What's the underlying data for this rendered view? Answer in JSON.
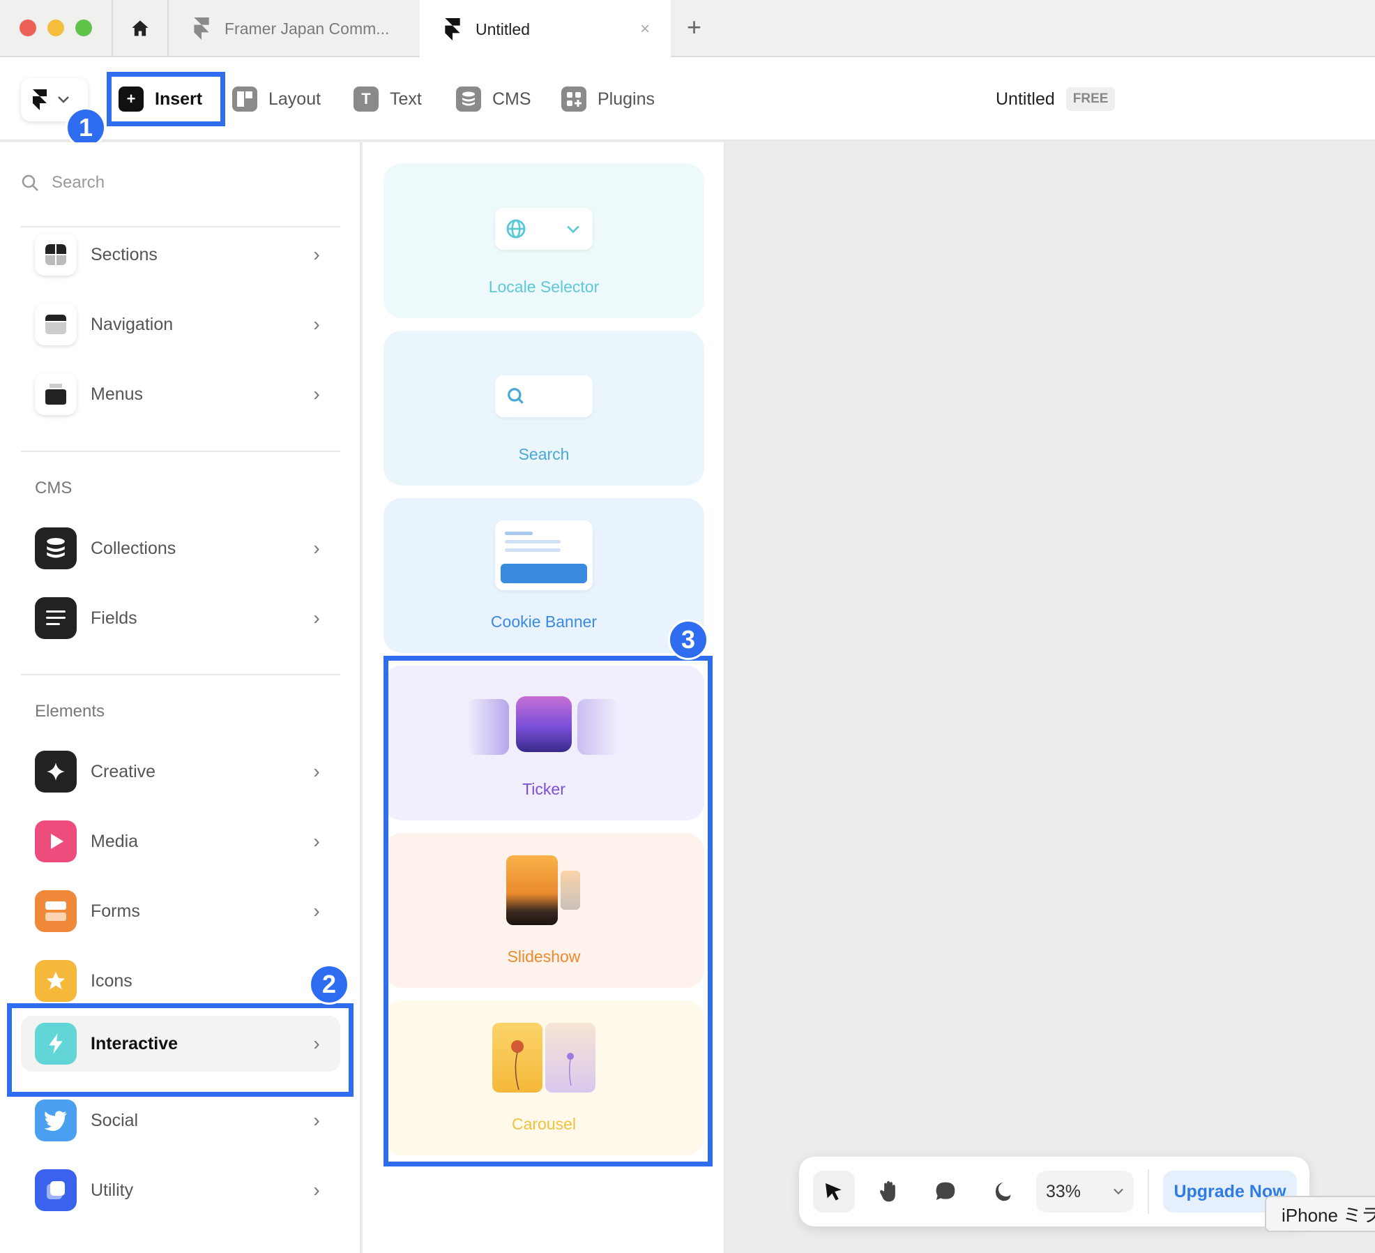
{
  "browser": {
    "tabs": [
      {
        "label": "Framer Japan Comm..."
      },
      {
        "label": "Untitled"
      }
    ],
    "new_tab": "+",
    "close": "×"
  },
  "toolbar": {
    "insert": "Insert",
    "layout": "Layout",
    "text": "Text",
    "cms": "CMS",
    "plugins": "Plugins",
    "project_title": "Untitled",
    "plan_badge": "FREE"
  },
  "annotations": [
    "1",
    "2",
    "3"
  ],
  "sidebar": {
    "search_placeholder": "Search",
    "sections": [
      {
        "label": "Sections",
        "icon": "sections-grid-icon"
      },
      {
        "label": "Navigation",
        "icon": "navigation-bar-icon"
      },
      {
        "label": "Menus",
        "icon": "menus-icon"
      }
    ],
    "cms_title": "CMS",
    "cms_items": [
      {
        "label": "Collections",
        "icon": "database-icon"
      },
      {
        "label": "Fields",
        "icon": "fields-lines-icon"
      }
    ],
    "elements_title": "Elements",
    "elements": [
      {
        "label": "Creative",
        "icon": "sparkle-icon",
        "color": "#222222"
      },
      {
        "label": "Media",
        "icon": "play-icon",
        "color": "#ec4d7c"
      },
      {
        "label": "Forms",
        "icon": "form-icon",
        "color": "#f0883a"
      },
      {
        "label": "Icons",
        "icon": "star-icon",
        "color": "#f5b83a"
      },
      {
        "label": "Interactive",
        "icon": "lightning-icon",
        "color": "#62d6d6",
        "active": true
      },
      {
        "label": "Social",
        "icon": "twitter-bird-icon",
        "color": "#4a9ff0"
      },
      {
        "label": "Utility",
        "icon": "utility-square-icon",
        "color": "#3a62ec"
      }
    ]
  },
  "components": [
    {
      "label": "Locale Selector",
      "bg": "#edf9fb",
      "color": "#5cc8d8"
    },
    {
      "label": "Search",
      "bg": "#ebf6fc",
      "color": "#48a8d8"
    },
    {
      "label": "Cookie Banner",
      "bg": "#e8f3fd",
      "color": "#3a8ae0"
    },
    {
      "label": "Ticker",
      "bg": "#f1effd",
      "color": "#7a4fd8"
    },
    {
      "label": "Slideshow",
      "bg": "#fdf3ec",
      "color": "#ea8a2e"
    },
    {
      "label": "Carousel",
      "bg": "#fef9ea",
      "color": "#f0c140"
    }
  ],
  "bottom_bar": {
    "zoom": "33%",
    "upgrade": "Upgrade Now"
  },
  "tooltip": "iPhone ミラ"
}
